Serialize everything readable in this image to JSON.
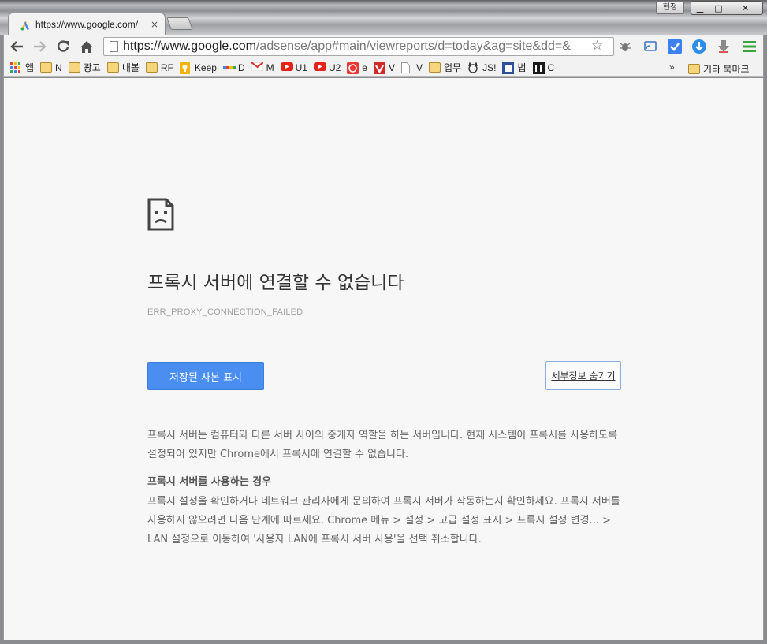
{
  "window": {
    "user_badge": "현정",
    "min_label": "▁",
    "max_label": "□",
    "close_label": "✕"
  },
  "tab": {
    "title": "https://www.google.com/",
    "close": "×"
  },
  "toolbar": {
    "url_host": "https://www.google.com",
    "url_path": "/adsense/app#main/viewreports/d=today&ag=site&dd=&"
  },
  "bookmarks": {
    "items": [
      {
        "label": "앱",
        "icon": "apps-icon"
      },
      {
        "label": "N",
        "icon": "folder-icon"
      },
      {
        "label": "광고",
        "icon": "folder-icon"
      },
      {
        "label": "내볼",
        "icon": "folder-icon"
      },
      {
        "label": "RF",
        "icon": "folder-icon"
      },
      {
        "label": "Keep",
        "icon": "keep-icon"
      },
      {
        "label": "D",
        "icon": "dots-icon"
      },
      {
        "label": "M",
        "icon": "gmail-icon"
      },
      {
        "label": "U1",
        "icon": "youtube-icon"
      },
      {
        "label": "U2",
        "icon": "youtube-icon"
      },
      {
        "label": "e",
        "icon": "e-icon"
      },
      {
        "label": "V",
        "icon": "v-icon"
      },
      {
        "label": "V",
        "icon": "page-icon"
      },
      {
        "label": "업무",
        "icon": "folder-icon"
      },
      {
        "label": "JS!",
        "icon": "cat-icon"
      },
      {
        "label": "법",
        "icon": "law-icon"
      },
      {
        "label": "C",
        "icon": "un-icon"
      }
    ],
    "more": "»",
    "other": "기타 북마크"
  },
  "page": {
    "title": "프록시 서버에 연결할 수 없습니다",
    "error_code": "ERR_PROXY_CONNECTION_FAILED",
    "primary_button": "저장된 사본 표시",
    "details_button": "세부정보 숨기기",
    "paragraph1": "프록시 서버는 컴퓨터와 다른 서버 사이의 중개자 역할을 하는 서버입니다. 현재 시스템이 프록시를 사용하도록 설정되어 있지만 Chrome에서 프록시에 연결할 수 없습니다.",
    "heading": "프록시 서버를 사용하는 경우",
    "paragraph2": "프록시 설정을 확인하거나 네트워크 관리자에게 문의하여 프록시 서버가 작동하는지 확인하세요. 프록시 서버를 사용하지 않으려면 다음 단계에 따르세요. Chrome 메뉴 > 설정 > 고급 설정 표시 > 프록시 설정 변경... > LAN 설정으로 이동하여 '사용자 LAN에 프록시 서버 사용'을 선택 취소합니다."
  },
  "colors": {
    "primary_button": "#4a8ef2",
    "page_background": "#f7f7f7",
    "chrome_toolbar": "#f2f2f2"
  }
}
